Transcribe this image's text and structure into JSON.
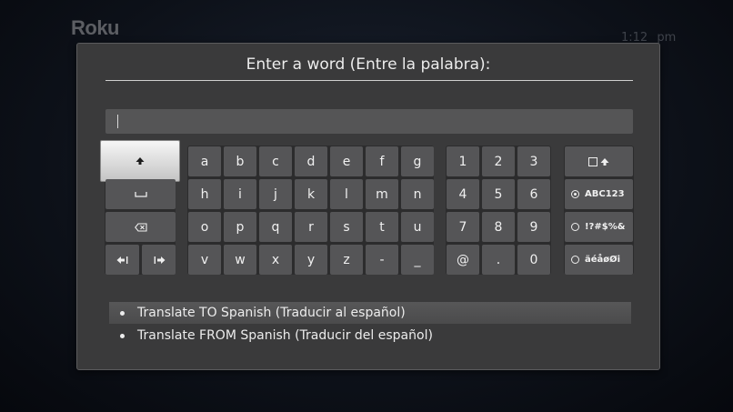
{
  "brand": {
    "logo_text": "Roku"
  },
  "clock": {
    "time": "1:12 pm"
  },
  "dialog": {
    "title": "Enter a word (Entre la palabra):",
    "input_value": ""
  },
  "keyboard": {
    "letters": [
      "a",
      "b",
      "c",
      "d",
      "e",
      "f",
      "g",
      "h",
      "i",
      "j",
      "k",
      "l",
      "m",
      "n",
      "o",
      "p",
      "q",
      "r",
      "s",
      "t",
      "u",
      "v",
      "w",
      "x",
      "y",
      "z",
      "-",
      "_"
    ],
    "numbers": [
      "1",
      "2",
      "3",
      "4",
      "5",
      "6",
      "7",
      "8",
      "9",
      "@",
      ".",
      "0"
    ],
    "modes": {
      "abc": "ABC123",
      "symbols": "!?#$%&",
      "accents": "äéåøØi"
    },
    "selected_mode": "abc"
  },
  "options": [
    {
      "label": "Translate TO Spanish (Traducir al español)",
      "selected": true
    },
    {
      "label": "Translate FROM Spanish (Traducir del español)",
      "selected": false
    }
  ],
  "icons": {
    "shift": "up-arrow-icon",
    "space": "space-icon",
    "backspace": "backspace-icon",
    "cursor_left": "cursor-left-icon",
    "cursor_right": "cursor-right-icon",
    "caps": "caps-lock-icon"
  },
  "colors": {
    "background": "#0d1119",
    "dialog": "#3a3a3b",
    "key": "#555557",
    "key_active": "#e6e6e6",
    "text": "#ececec"
  }
}
